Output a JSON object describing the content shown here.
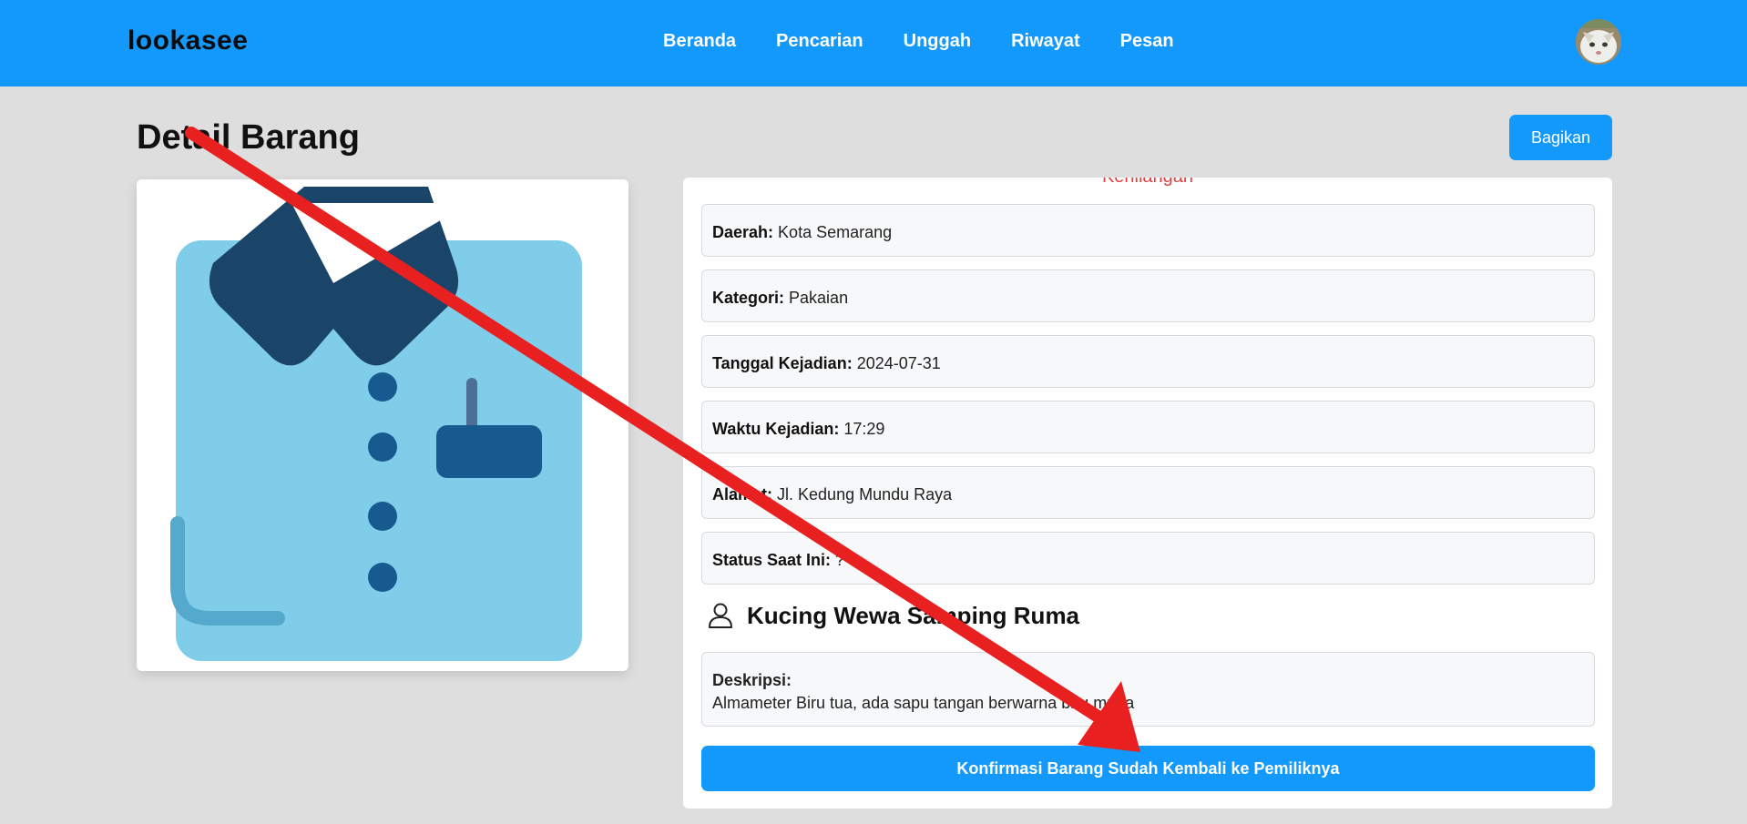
{
  "app": {
    "brand": "lookasee"
  },
  "nav": {
    "items": [
      {
        "label": "Beranda"
      },
      {
        "label": "Pencarian"
      },
      {
        "label": "Unggah"
      },
      {
        "label": "Riwayat"
      },
      {
        "label": "Pesan"
      }
    ]
  },
  "page": {
    "title": "Detail Barang",
    "share_label": "Bagikan"
  },
  "item": {
    "status_text": "Kehilangan",
    "fields": [
      {
        "key": "Daerah:",
        "value": "Kota Semarang"
      },
      {
        "key": "Kategori:",
        "value": "Pakaian"
      },
      {
        "key": "Tanggal Kejadian:",
        "value": "2024-07-31"
      },
      {
        "key": "Waktu Kejadian:",
        "value": "17:29"
      },
      {
        "key": "Alamat:",
        "value": "Jl. Kedung Mundu Raya"
      },
      {
        "key": "Status Saat Ini:",
        "value": "?"
      }
    ],
    "owner_name": "Kucing Wewa Samping Ruma",
    "description_label": "Deskripsi:",
    "description": "Almameter Biru tua, ada sapu tangan berwarna biru muda",
    "confirm_label": "Konfirmasi Barang Sudah Kembali ke Pemiliknya"
  },
  "icons": {
    "user": "user-icon",
    "image": "shirt-icon",
    "avatar": "avatar-cat"
  },
  "colors": {
    "primary": "#1399fb",
    "background": "#dedede",
    "annotation_arrow": "#e8201f",
    "status_text": "#e04040"
  }
}
